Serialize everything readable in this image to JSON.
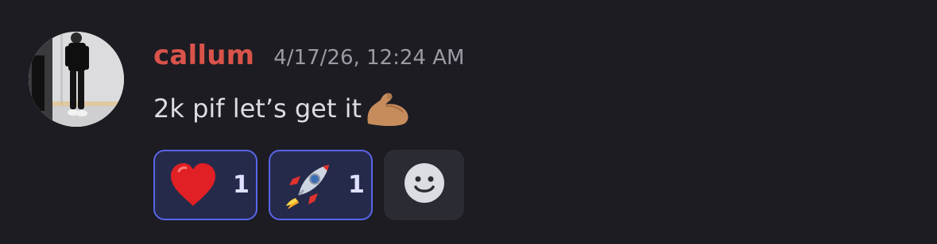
{
  "message": {
    "username": "callum",
    "username_color": "#d9534a",
    "timestamp": "4/17/26, 12:24 AM",
    "text": "2k pif let’s get it",
    "text_emoji": "flexed-biceps-icon"
  },
  "avatar": {
    "icon": "user-avatar-photo"
  },
  "reactions": [
    {
      "emoji": "red-heart-icon",
      "count": "1",
      "selected": true
    },
    {
      "emoji": "rocket-icon",
      "count": "1",
      "selected": true
    }
  ],
  "add_reaction": {
    "icon": "add-reaction-smiley-icon"
  },
  "colors": {
    "background": "#1c1c22",
    "accent": "#5865e8",
    "reaction_bg": "#262a4a"
  }
}
